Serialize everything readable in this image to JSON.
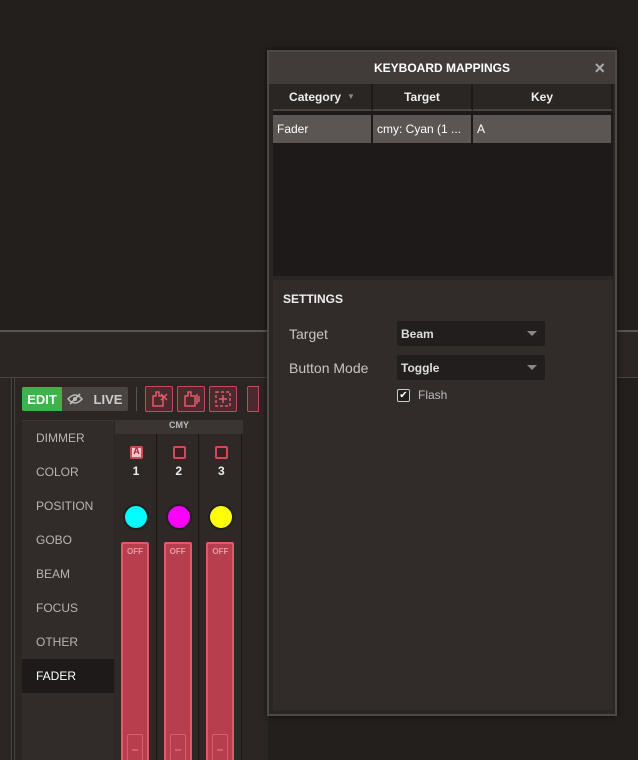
{
  "toolbar": {
    "edit_label": "EDIT",
    "live_label": "LIVE"
  },
  "categories": [
    {
      "label": "DIMMER",
      "active": false
    },
    {
      "label": "COLOR",
      "active": false
    },
    {
      "label": "POSITION",
      "active": false
    },
    {
      "label": "GOBO",
      "active": false
    },
    {
      "label": "BEAM",
      "active": false
    },
    {
      "label": "FOCUS",
      "active": false
    },
    {
      "label": "OTHER",
      "active": false
    },
    {
      "label": "FADER",
      "active": true
    }
  ],
  "group": {
    "name": "CMY",
    "channels": [
      {
        "number": "1",
        "color": "#00ffff",
        "fader_label": "OFF",
        "mapped_key": "A"
      },
      {
        "number": "2",
        "color": "#ff00ff",
        "fader_label": "OFF"
      },
      {
        "number": "3",
        "color": "#ffff00",
        "fader_label": "OFF"
      }
    ]
  },
  "dialog": {
    "title": "KEYBOARD MAPPINGS",
    "close_icon": "×",
    "columns": [
      "Category",
      "Target",
      "Key"
    ],
    "rows": [
      {
        "category": "Fader",
        "target": "cmy: Cyan (1 ...",
        "key": "A"
      }
    ],
    "settings": {
      "title": "SETTINGS",
      "target_label": "Target",
      "target_value": "Beam",
      "button_mode_label": "Button Mode",
      "button_mode_value": "Toggle",
      "flash_label": "Flash",
      "flash_checked": true
    }
  }
}
